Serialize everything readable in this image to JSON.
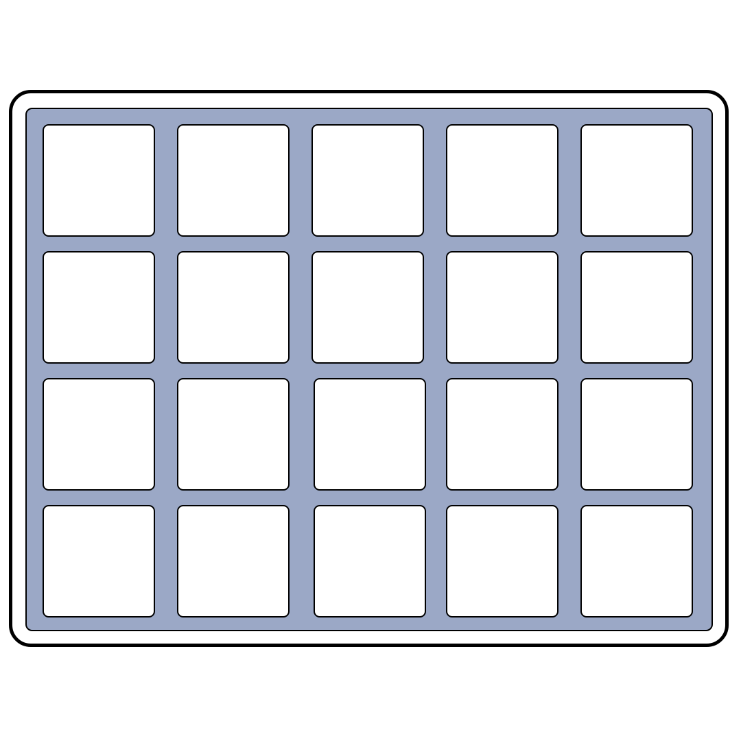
{
  "colors": {
    "tray_fill": "#9ba8c6",
    "cell_fill": "#ffffff",
    "outline": "#000000",
    "background": "#ffffff"
  },
  "grid": {
    "rows": 4,
    "columns": 5
  }
}
